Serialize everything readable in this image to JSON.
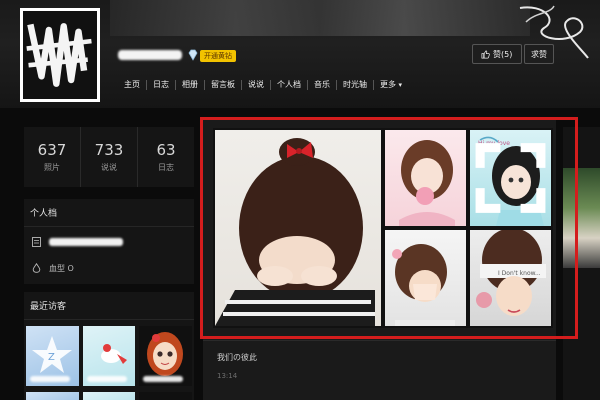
{
  "header": {
    "vip_badge": "开通黄钻",
    "nav": [
      "主页",
      "日志",
      "相册",
      "留言板",
      "说说",
      "个人档",
      "音乐",
      "时光轴",
      "更多"
    ],
    "like_label": "赞(5)",
    "ask_label": "求赞"
  },
  "stats": [
    {
      "value": "637",
      "label": "照片"
    },
    {
      "value": "733",
      "label": "说说"
    },
    {
      "value": "63",
      "label": "日志"
    }
  ],
  "profile": {
    "title": "个人档",
    "blood_type": "血型 O"
  },
  "visitors": {
    "title": "最近访客"
  },
  "album": {
    "caption_b": "Hi my love",
    "caption_d": "I Don't know..."
  },
  "post": {
    "title": "我们の彼此",
    "time": "13:14"
  },
  "colors": {
    "highlight": "#d41d1d",
    "vip": "#f2c200"
  }
}
